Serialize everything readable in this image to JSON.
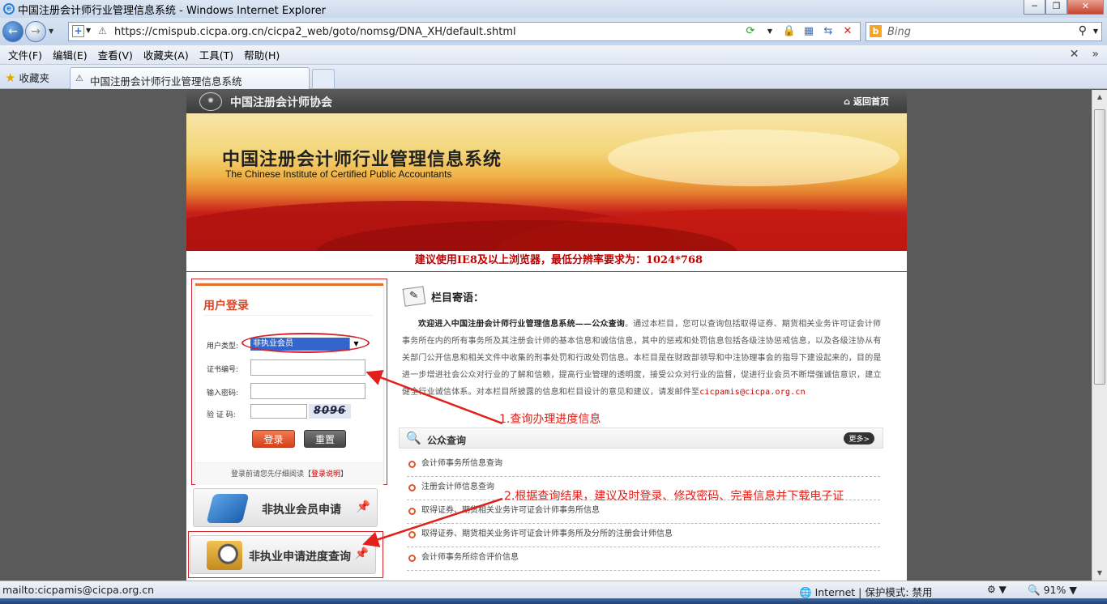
{
  "window": {
    "title": "中国注册会计师行业管理信息系统 - Windows Internet Explorer",
    "min": "─",
    "max": "❐",
    "close": "✕"
  },
  "addressbar": {
    "url": "https://cmispub.cicpa.org.cn/cicpa2_web/goto/nomsg/DNA_XH/default.shtml",
    "search_placeholder": "Bing"
  },
  "menu": {
    "items": [
      "文件(F)",
      "编辑(E)",
      "查看(V)",
      "收藏夹(A)",
      "工具(T)",
      "帮助(H)"
    ]
  },
  "tabs": {
    "favorites_label": "收藏夹",
    "active_tab": "中国注册会计师行业管理信息系统"
  },
  "site": {
    "org_name": "中国注册会计师协会",
    "home_link": "返回首页",
    "banner_title": "中国注册会计师行业管理信息系统",
    "banner_subtitle": "The Chinese Institute of Certified Public Accountants",
    "notice": "建议使用IE8及以上浏览器，最低分辨率要求为：1024*768"
  },
  "login": {
    "heading": "用户登录",
    "user_type_label": "用户类型:",
    "user_type_value": "非执业会员",
    "cert_no_label": "证书编号:",
    "password_label": "输入密码:",
    "captcha_label": "验 证 码:",
    "captcha_text": "8096",
    "login_button": "登录",
    "reset_button": "重置",
    "footer_text": "登录前请您先仔细阅读【",
    "footer_link": "登录说明",
    "footer_end": "】"
  },
  "side_buttons": {
    "apply": "非执业会员申请",
    "progress": "非执业申请进度查询"
  },
  "column": {
    "title": "栏目寄语：",
    "intro_bold": "欢迎进入中国注册会计师行业管理信息系统——公众查询",
    "intro_text": "。通过本栏目，您可以查询包括取得证券、期货相关业务许可证会计师事务所在内的所有事务所及其注册会计师的基本信息和诚信信息，其中的惩戒和处罚信息包括各级注协惩戒信息，以及各级注协从有关部门公开信息和相关文件中收集的刑事处罚和行政处罚信息。本栏目是在财政部领导和中注协理事会的指导下建设起来的，目的是进一步增进社会公众对行业的了解和信赖，提高行业管理的透明度，接受公众对行业的监督，促进行业会员不断增强诚信意识，建立健全行业诚信体系。对本栏目所披露的信息和栏目设计的意见和建议，请发邮件至",
    "intro_email": "cicpamis@cicpa.org.cn"
  },
  "query": {
    "title": "公众查询",
    "more": "更多>",
    "items": [
      "会计师事务所信息查询",
      "注册会计师信息查询",
      "取得证券、期货相关业务许可证会计师事务所信息",
      "取得证券、期货相关业务许可证会计师事务所及分所的注册会计师信息",
      "会计师事务所综合评价信息"
    ]
  },
  "annotations": {
    "note1": "1.查询办理进度信息",
    "note2": "2.根据查询结果，建议及时登录、修改密码、完善信息并下载电子证"
  },
  "status": {
    "left": "mailto:cicpamis@cicpa.org.cn",
    "zone": "Internet | 保护模式: 禁用",
    "zoom": "91%"
  },
  "colors": {
    "accent_red": "#c00000",
    "annotation_red": "#e0201a",
    "login_orange": "#d5492a"
  }
}
